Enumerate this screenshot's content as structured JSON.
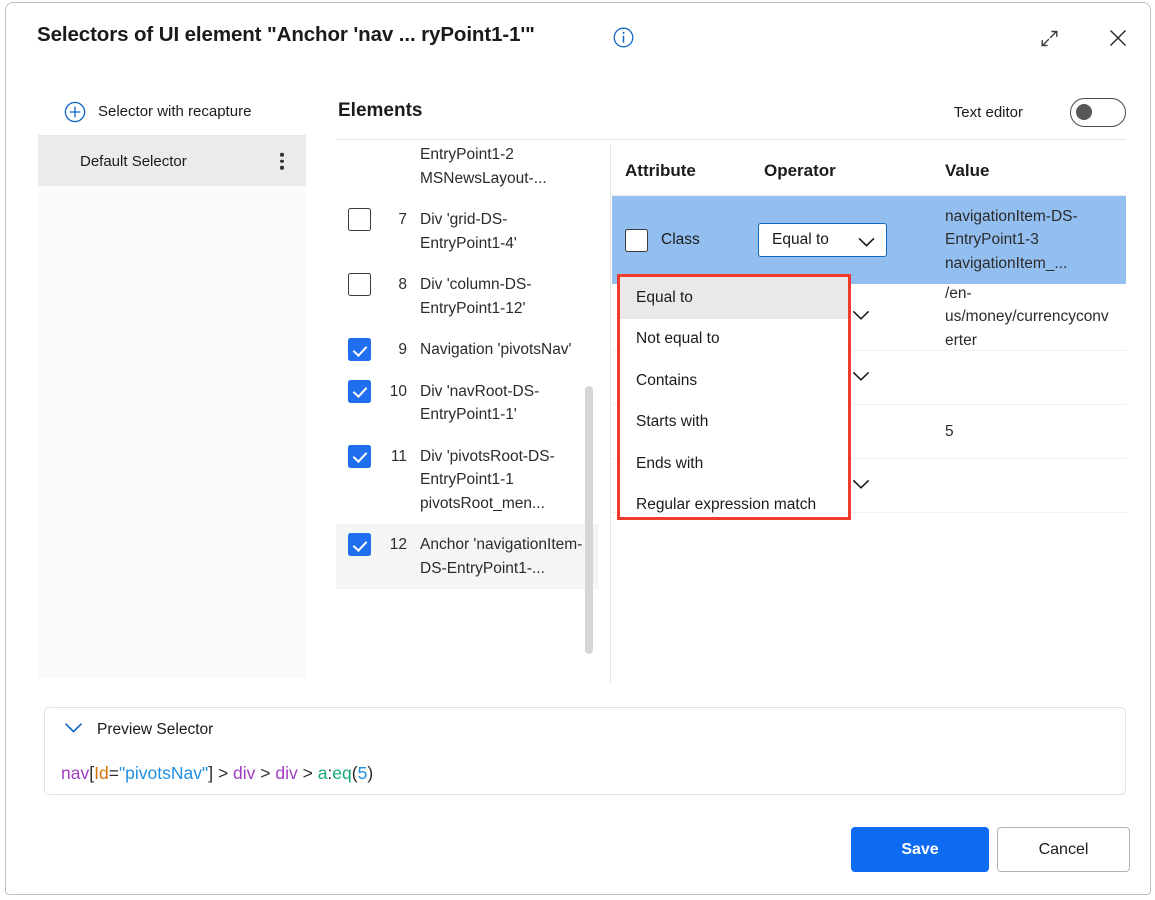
{
  "window": {
    "title": "Selectors of UI element \"Anchor 'nav ... ryPoint1-1'\"",
    "info_icon": "info-icon",
    "expand_icon": "expand-icon",
    "close_icon": "close-icon"
  },
  "sidebar": {
    "recapture_label": "Selector with recapture",
    "recapture_icon": "plus-circle-icon",
    "items": [
      {
        "label": "Default Selector",
        "menu_icon": "kebab-menu-icon",
        "selected": true
      }
    ]
  },
  "elements_panel": {
    "title": "Elements",
    "text_editor_label": "Text editor",
    "text_editor_on": false,
    "tree": [
      {
        "index": "",
        "label": "EntryPoint1-2 MSNewsLayout-...",
        "checked": null,
        "partial": true,
        "selected": false
      },
      {
        "index": "7",
        "label": "Div 'grid-DS-EntryPoint1-4'",
        "checked": false,
        "selected": false
      },
      {
        "index": "8",
        "label": "Div 'column-DS-EntryPoint1-12'",
        "checked": false,
        "selected": false
      },
      {
        "index": "9",
        "label": "Navigation 'pivotsNav'",
        "checked": true,
        "selected": false
      },
      {
        "index": "10",
        "label": "Div 'navRoot-DS-EntryPoint1-1'",
        "checked": true,
        "selected": false
      },
      {
        "index": "11",
        "label": "Div 'pivotsRoot-DS-EntryPoint1-1 pivotsRoot_men...",
        "checked": true,
        "selected": false
      },
      {
        "index": "12",
        "label": "Anchor 'navigationItem-DS-EntryPoint1-...",
        "checked": true,
        "selected": true
      }
    ]
  },
  "attributes_table": {
    "headers": {
      "attribute": "Attribute",
      "operator": "Operator",
      "value": "Value"
    },
    "rows": [
      {
        "attribute": "Class",
        "checked": false,
        "operator": "Equal to",
        "value": "navigationItem-DS-EntryPoint1-3 navigationItem_...",
        "highlighted": true,
        "has_chevron": true
      },
      {
        "attribute": "",
        "checked": false,
        "operator": "",
        "value": "/en-us/money/currencyconverter",
        "highlighted": false,
        "has_chevron": true
      },
      {
        "attribute": "",
        "checked": false,
        "operator": "",
        "value": "",
        "highlighted": false,
        "has_chevron": true
      },
      {
        "attribute": "",
        "checked": false,
        "operator": "",
        "value": "5",
        "highlighted": false,
        "has_chevron": false
      },
      {
        "attribute": "",
        "checked": false,
        "operator": "",
        "value": "",
        "highlighted": false,
        "has_chevron": true
      }
    ]
  },
  "operator_dropdown": {
    "open": true,
    "selected": "Equal to",
    "options": [
      "Equal to",
      "Not equal to",
      "Contains",
      "Starts with",
      "Ends with",
      "Regular expression match"
    ]
  },
  "preview_selector": {
    "label": "Preview Selector",
    "chevron_icon": "chevron-down-icon",
    "expanded": true,
    "code_tokens": [
      {
        "text": "nav",
        "color": "#a03cc0"
      },
      {
        "text": "[",
        "color": "#2b2b2b"
      },
      {
        "text": "Id",
        "color": "#d9720a"
      },
      {
        "text": "=",
        "color": "#2b2b2b"
      },
      {
        "text": "\"pivotsNav\"",
        "color": "#1f8fe0"
      },
      {
        "text": "]",
        "color": "#2b2b2b"
      },
      {
        "text": " > ",
        "color": "#2b2b2b"
      },
      {
        "text": "div",
        "color": "#a03cc0"
      },
      {
        "text": " > ",
        "color": "#2b2b2b"
      },
      {
        "text": "div",
        "color": "#a03cc0"
      },
      {
        "text": " > ",
        "color": "#2b2b2b"
      },
      {
        "text": "a",
        "color": "#19a974"
      },
      {
        "text": ":",
        "color": "#2b2b2b"
      },
      {
        "text": "eq",
        "color": "#19a974"
      },
      {
        "text": "(",
        "color": "#2b2b2b"
      },
      {
        "text": "5",
        "color": "#1f8fe0"
      },
      {
        "text": ")",
        "color": "#2b2b2b"
      }
    ]
  },
  "footer": {
    "save_label": "Save",
    "cancel_label": "Cancel"
  },
  "colors": {
    "accent_blue": "#0d6bf2",
    "checkbox_blue": "#1f6ff0",
    "row_highlight": "#93bff0",
    "dropdown_border": "#f03a2e",
    "combobox_border": "#0f6cbd"
  }
}
